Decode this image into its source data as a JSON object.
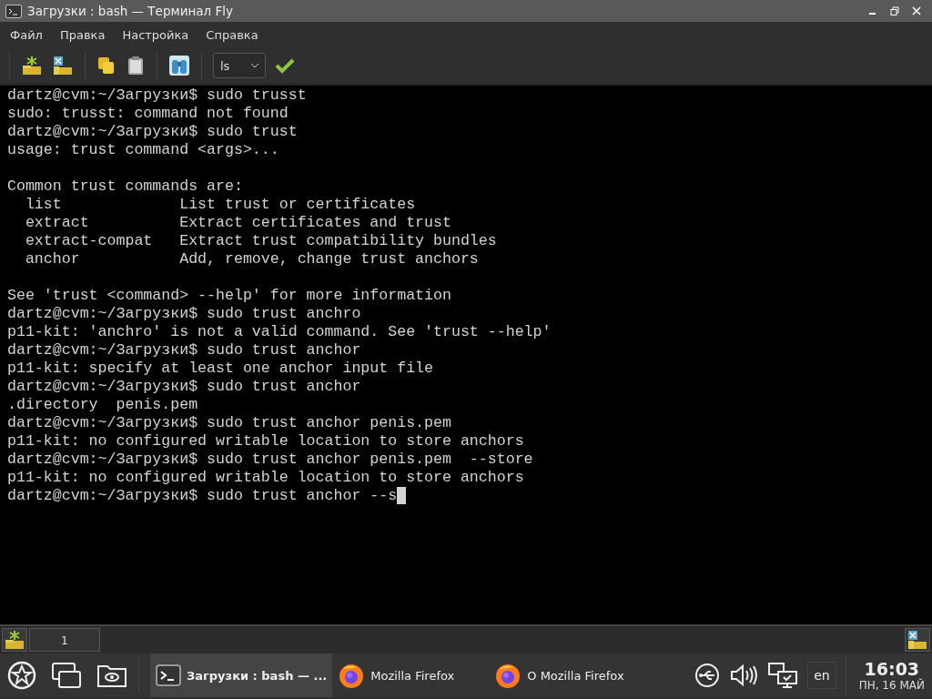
{
  "window": {
    "title": "Загрузки : bash — Терминал Fly"
  },
  "menu": [
    "Файл",
    "Правка",
    "Настройка",
    "Справка"
  ],
  "toolbar": {
    "command": {
      "value": "ls"
    }
  },
  "terminal": {
    "cursor": true,
    "blocks": [
      [
        "dartz@cvm:~/Загрузки$ sudo trusst",
        "sudo: trusst: command not found",
        "dartz@cvm:~/Загрузки$ sudo trust",
        "usage: trust command <args>..."
      ],
      [
        "Common trust commands are:",
        "  list             List trust or certificates",
        "  extract          Extract certificates and trust",
        "  extract-compat   Extract trust compatibility bundles",
        "  anchor           Add, remove, change trust anchors"
      ],
      [
        "See 'trust <command> --help' for more information",
        "dartz@cvm:~/Загрузки$ sudo trust anchro",
        "p11-kit: 'anchro' is not a valid command. See 'trust --help'",
        "dartz@cvm:~/Загрузки$ sudo trust anchor",
        "p11-kit: specify at least one anchor input file",
        "dartz@cvm:~/Загрузки$ sudo trust anchor",
        ".directory  penis.pem",
        "dartz@cvm:~/Загрузки$ sudo trust anchor penis.pem",
        "p11-kit: no configured writable location to store anchors",
        "dartz@cvm:~/Загрузки$ sudo trust anchor penis.pem  --store",
        "p11-kit: no configured writable location to store anchors",
        "dartz@cvm:~/Загрузки$ sudo trust anchor --s"
      ]
    ]
  },
  "terminal_tabs": [
    {
      "label": "1",
      "selected": true
    }
  ],
  "taskbar": {
    "tasks": [
      {
        "label": "Загрузки : bash — ...",
        "kind": "terminal",
        "selected": true
      },
      {
        "label": "Mozilla Firefox",
        "kind": "browser",
        "selected": false
      },
      {
        "label": "О Mozilla Firefox",
        "kind": "browser",
        "selected": false
      }
    ],
    "language": "en",
    "time": "16:03",
    "date": "ПН, 16 МАЙ"
  }
}
